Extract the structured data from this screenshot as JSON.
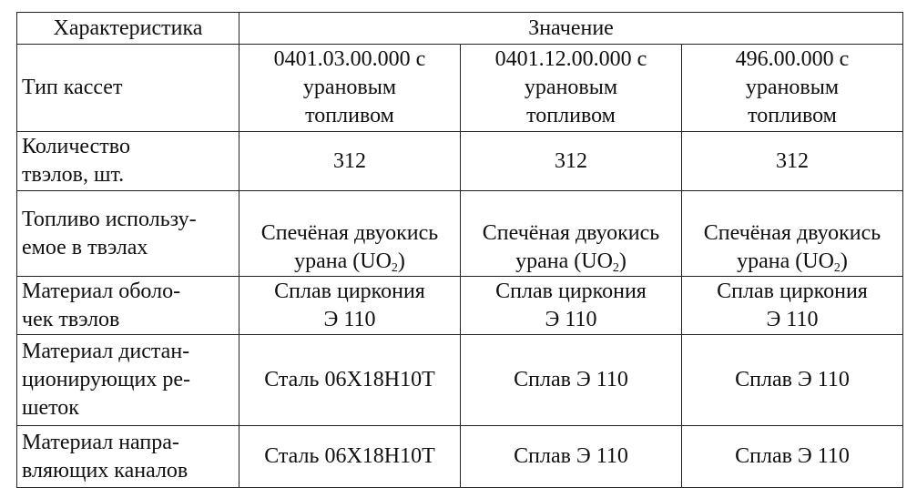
{
  "table": {
    "header": {
      "characteristic": "Характеристика",
      "value": "Значение"
    },
    "rows": [
      {
        "label": "Тип кассет",
        "cells": [
          "0401.03.00.000 с\nурановым\nтопливом",
          "0401.12.00.000 с\nурановым\nтопливом",
          "496.00.000 с\nурановым\nтопливом"
        ]
      },
      {
        "label": "Количество\nтвэлов, шт.",
        "cells": [
          "312",
          "312",
          "312"
        ]
      },
      {
        "label": "Топливо использу-\nемое в твэлах",
        "cells_line1": [
          "Спечёная двуокись",
          "Спечёная двуокись",
          "Спечёная двуокись"
        ],
        "cells_line2_pre": [
          "урана (UO",
          "урана (UO",
          "урана (UO"
        ],
        "cells_sub": [
          "2",
          "2",
          "2"
        ],
        "cells_line2_post": [
          ")",
          ")",
          ")"
        ]
      },
      {
        "label": "Материал оболо-\nчек твэлов",
        "cells": [
          "Сплав циркония\nЭ 110",
          "Сплав циркония\nЭ 110",
          "Сплав циркония\nЭ 110"
        ]
      },
      {
        "label": "Материал  дистан-\nционирующих ре-\nшеток",
        "cells": [
          "Сталь 06Х18Н10Т",
          "Сплав Э 110",
          "Сплав Э 110"
        ]
      },
      {
        "label": "Материал напра-\nвляющих каналов",
        "cells": [
          "Сталь 06Х18Н10Т",
          "Сплав Э 110",
          "Сплав Э 110"
        ]
      }
    ]
  }
}
